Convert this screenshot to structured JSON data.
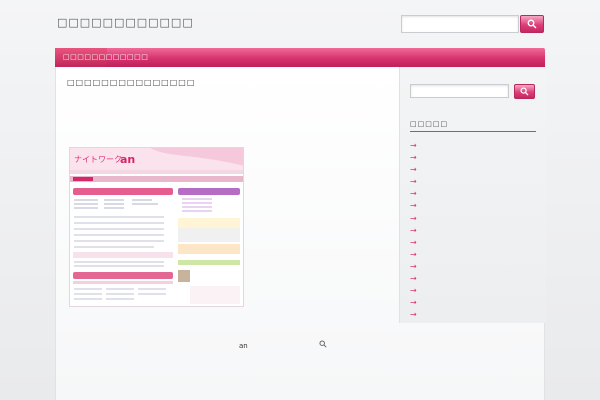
{
  "header": {
    "site_title": "□□□□□□□□□□□□",
    "search_value": "",
    "search_icon": "magnifier-icon"
  },
  "nav": {
    "items": [
      {
        "label": "□□□□□□□□□□□□"
      }
    ]
  },
  "post": {
    "title": "□□□□□□□□□□□□□□□"
  },
  "thumbnail": {
    "logo": "ナイトワーク",
    "logo_suffix": "an"
  },
  "sidebar": {
    "search_value": "",
    "heading": "□□□□□",
    "items": [
      {
        "arrow": "→"
      },
      {
        "arrow": "→"
      },
      {
        "arrow": "→"
      },
      {
        "arrow": "→"
      },
      {
        "arrow": "→"
      },
      {
        "arrow": "→"
      },
      {
        "arrow": "→"
      },
      {
        "arrow": "→"
      },
      {
        "arrow": "→"
      },
      {
        "arrow": "→"
      },
      {
        "arrow": "→"
      },
      {
        "arrow": "→"
      },
      {
        "arrow": "→"
      },
      {
        "arrow": "→"
      },
      {
        "arrow": "→"
      }
    ]
  },
  "footer": {
    "text": "an",
    "icon": "search-icon"
  },
  "colors": {
    "accent": "#d6336e",
    "accent_dark": "#bf2159"
  }
}
